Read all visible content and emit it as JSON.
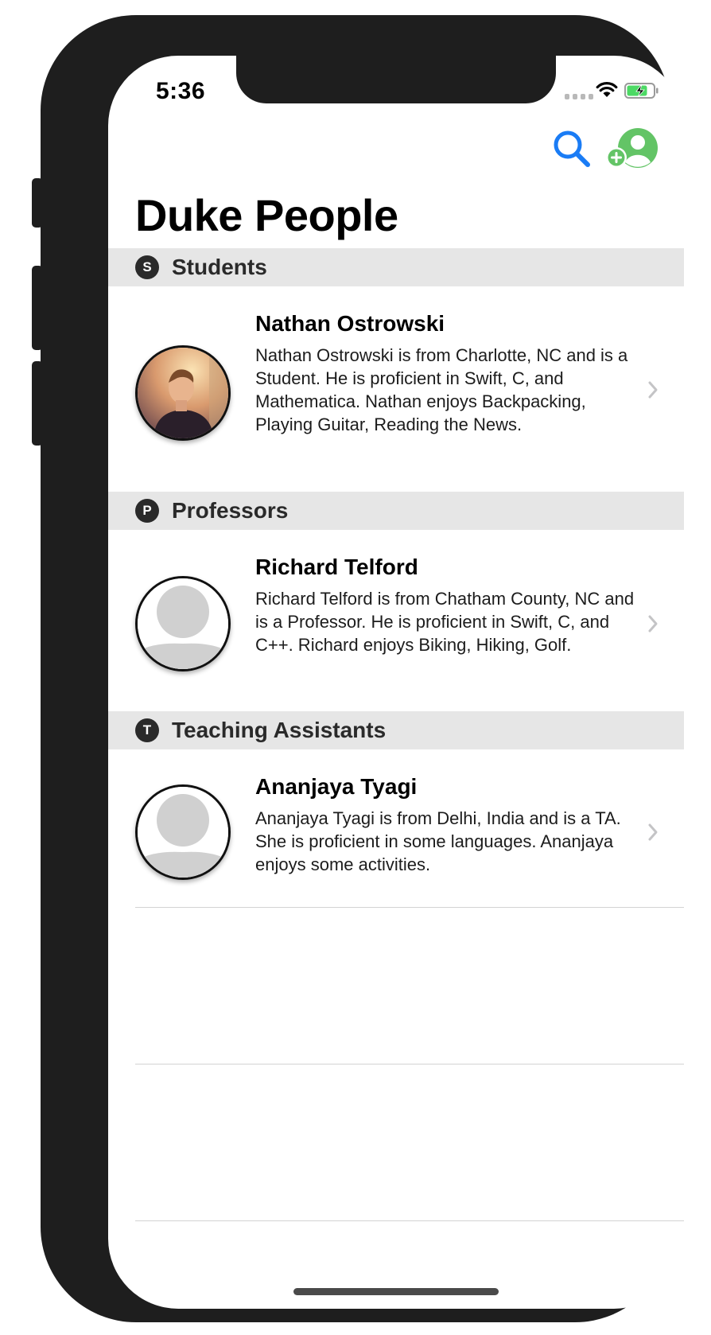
{
  "status_bar": {
    "time": "5:36"
  },
  "nav": {
    "title": "Duke People",
    "search_icon": "search-icon",
    "add_person_icon": "add-person-icon",
    "accent_blue": "#1a7cf5",
    "accent_green": "#63c466"
  },
  "sections": [
    {
      "badge": "S",
      "title": "Students",
      "people": [
        {
          "name": "Nathan Ostrowski",
          "description": "Nathan Ostrowski is from Charlotte, NC and is a Student. He is proficient in Swift, C, and Mathematica. Nathan enjoys Backpacking, Playing Guitar, Reading the News."
        }
      ]
    },
    {
      "badge": "P",
      "title": "Professors",
      "people": [
        {
          "name": "Richard Telford",
          "description": "Richard Telford is from Chatham County, NC and is a Professor. He is proficient in Swift, C, and C++. Richard enjoys Biking, Hiking, Golf."
        }
      ]
    },
    {
      "badge": "T",
      "title": "Teaching Assistants",
      "people": [
        {
          "name": "Ananjaya Tyagi",
          "description": "Ananjaya Tyagi is from Delhi, India and is a TA. She is proficient in some languages. Ananjaya enjoys some activities."
        }
      ]
    }
  ]
}
